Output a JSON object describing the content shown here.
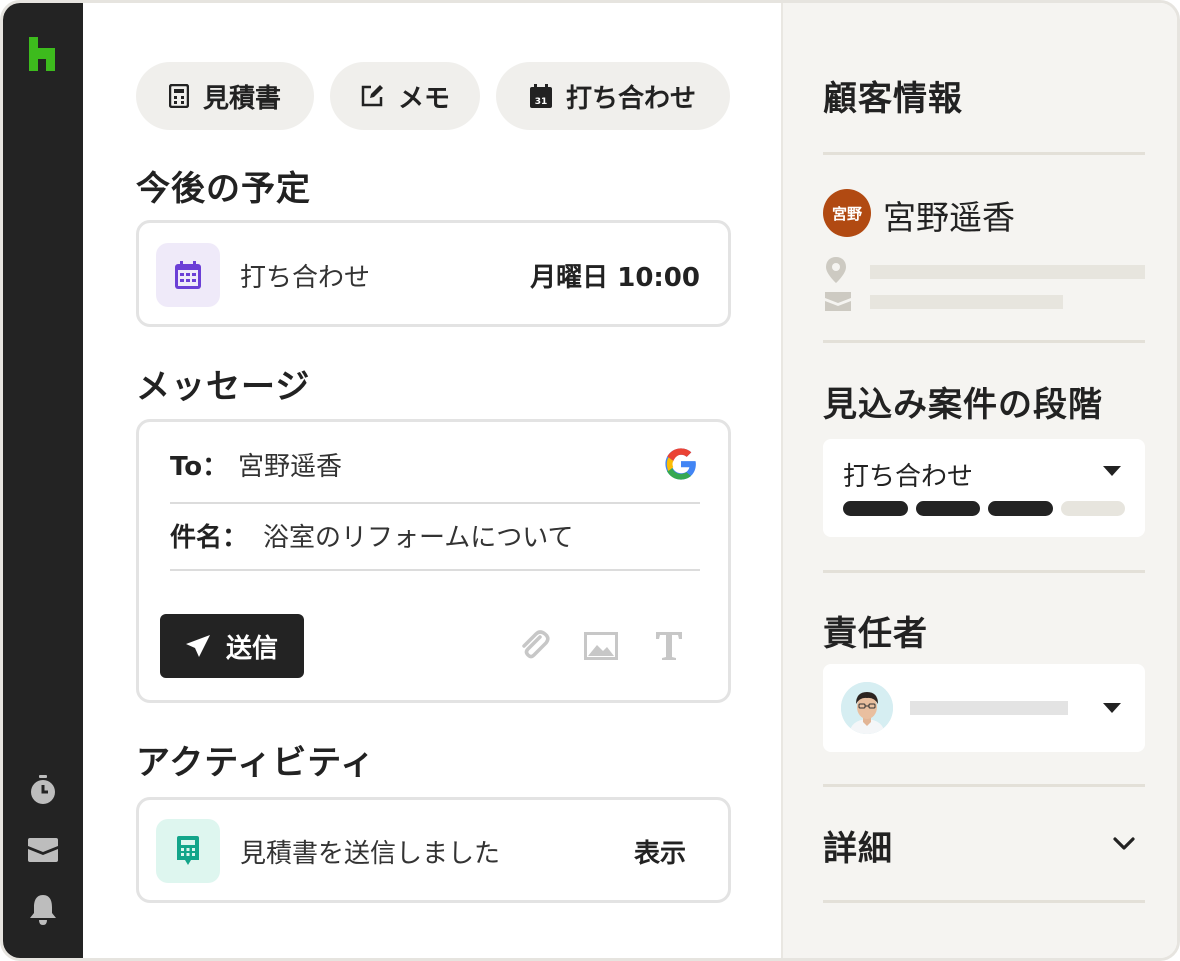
{
  "toolbar": {
    "estimate_label": "見積書",
    "memo_label": "メモ",
    "meeting_label": "打ち合わせ"
  },
  "upcoming": {
    "heading": "今後の予定",
    "event_title": "打ち合わせ",
    "event_time": "月曜日 10:00"
  },
  "message": {
    "heading": "メッセージ",
    "to_label": "To：",
    "to_value": "宮野遥香",
    "subject_label": "件名：",
    "subject_value": "浴室のリフォームについて",
    "send_label": "送信"
  },
  "activity": {
    "heading": "アクティビティ",
    "item_text": "見積書を送信しました",
    "view_label": "表示"
  },
  "customer": {
    "heading": "顧客情報",
    "avatar_text": "宮野",
    "name": "宮野遥香"
  },
  "stage": {
    "heading": "見込み案件の段階",
    "selected": "打ち合わせ",
    "progress_filled": 3,
    "progress_total": 4
  },
  "owner": {
    "heading": "責任者"
  },
  "details": {
    "heading": "詳細"
  },
  "colors": {
    "brand_green": "#3dbb1d",
    "calendar_purple": "#6b3fd6",
    "calculator_teal": "#13a58a",
    "customer_avatar": "#b14a12",
    "dark": "#232323"
  }
}
